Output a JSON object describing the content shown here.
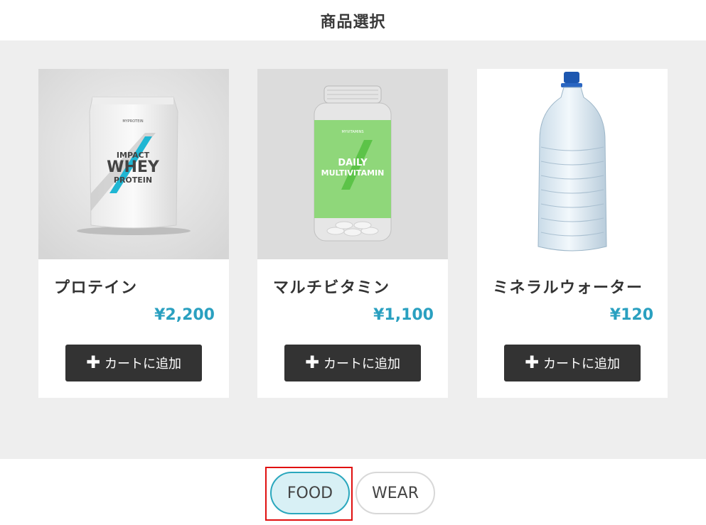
{
  "header": {
    "title": "商品選択"
  },
  "products": [
    {
      "name": "プロテイン",
      "price": "¥2,200",
      "button_label": "カートに追加",
      "image_label": "IMPACT WHEY PROTEIN",
      "brand": "MYPROTEIN"
    },
    {
      "name": "マルチビタミン",
      "price": "¥1,100",
      "button_label": "カートに追加",
      "image_label": "DAILY MULTIVITAMIN",
      "brand": "MYVITAMINS"
    },
    {
      "name": "ミネラルウォーター",
      "price": "¥120",
      "button_label": "カートに追加"
    }
  ],
  "tabs": [
    {
      "label": "FOOD",
      "selected": true
    },
    {
      "label": "WEAR",
      "selected": false
    }
  ],
  "colors": {
    "accent": "#2aa0c0",
    "button": "#333333",
    "background": "#eeeeee",
    "highlight": "#e01010"
  },
  "icons": {
    "add": "plus-icon"
  }
}
